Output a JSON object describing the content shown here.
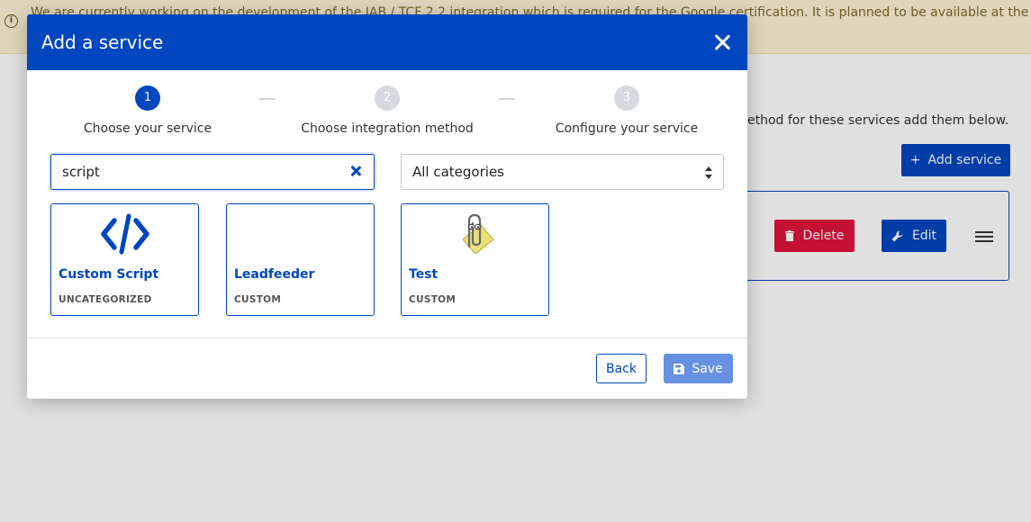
{
  "background": {
    "banner_text": "We are currently working on the development of the IAB / TCF 2.2 integration which is required for the Google certification. It is planned to be available at the end of September",
    "description_text": "ethod for these services add them below.",
    "add_service_label": "Add service",
    "delete_label": "Delete",
    "edit_label": "Edit"
  },
  "modal": {
    "title": "Add a service",
    "steps": [
      {
        "number": "1",
        "label": "Choose your service",
        "active": true
      },
      {
        "number": "2",
        "label": "Choose integration method",
        "active": false
      },
      {
        "number": "3",
        "label": "Configure your service",
        "active": false
      }
    ],
    "search": {
      "value": "script",
      "placeholder": ""
    },
    "category_select": {
      "selected": "All categories"
    },
    "services": [
      {
        "name": "Custom Script",
        "category": "UNCATEGORIZED",
        "icon": "code-icon"
      },
      {
        "name": "Leadfeeder",
        "category": "CUSTOM",
        "icon": ""
      },
      {
        "name": "Test",
        "category": "CUSTOM",
        "icon": "paperclip-icon"
      }
    ],
    "footer": {
      "back_label": "Back",
      "save_label": "Save"
    }
  },
  "colors": {
    "primary": "#0046be",
    "danger": "#e0143c",
    "save_disabled": "#6690e0"
  }
}
